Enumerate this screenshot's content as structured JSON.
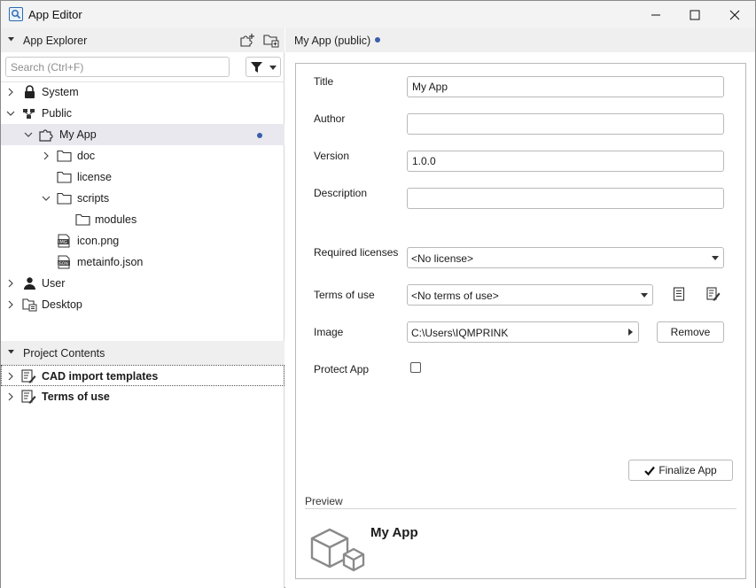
{
  "window": {
    "title": "App Editor"
  },
  "explorer": {
    "header": "App Explorer",
    "search_placeholder": "Search (Ctrl+F)",
    "tree": [
      {
        "label": "System",
        "icon": "lock-icon"
      },
      {
        "label": "Public",
        "icon": "network-icon"
      },
      {
        "label": "My App",
        "icon": "puzzle-icon",
        "selected": true,
        "modified": true
      },
      {
        "label": "doc",
        "icon": "folder-icon"
      },
      {
        "label": "license",
        "icon": "folder-icon"
      },
      {
        "label": "scripts",
        "icon": "folder-icon"
      },
      {
        "label": "modules",
        "icon": "folder-icon"
      },
      {
        "label": "icon.png",
        "icon": "image-file-icon"
      },
      {
        "label": "metainfo.json",
        "icon": "json-file-icon"
      },
      {
        "label": "User",
        "icon": "user-icon"
      },
      {
        "label": "Desktop",
        "icon": "desktop-icon"
      }
    ]
  },
  "project_contents": {
    "header": "Project Contents",
    "items": [
      {
        "label": "CAD import templates",
        "icon": "edit-document-icon"
      },
      {
        "label": "Terms of use",
        "icon": "edit-document-icon"
      }
    ]
  },
  "document": {
    "tab_label": "My App (public)",
    "form": {
      "title_label": "Title",
      "title_value": "My App",
      "author_label": "Author",
      "author_value": "",
      "version_label": "Version",
      "version_value": "1.0.0",
      "description_label": "Description",
      "description_value": "",
      "licenses_label": "Required licenses",
      "licenses_value": "<No license>",
      "terms_label": "Terms of use",
      "terms_value": "<No terms of use>",
      "image_label": "Image",
      "image_value": "C:\\Users\\IQMPRINK",
      "remove_label": "Remove",
      "protect_label": "Protect App",
      "protect_checked": false,
      "finalize_label": "Finalize App"
    },
    "preview": {
      "heading": "Preview",
      "app_name": "My App"
    }
  },
  "colors": {
    "accent_dot": "#3b5ea8",
    "selection": "#e8e8ee",
    "header_bg": "#efefef"
  }
}
